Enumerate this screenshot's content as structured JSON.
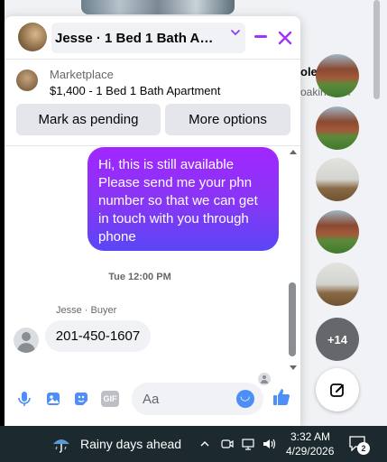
{
  "background": {
    "profile_text": "ole",
    "profile_sub": "oakin...om"
  },
  "chat": {
    "title": "Jesse · 1 Bed 1 Bath Apart...",
    "marketplace": {
      "label": "Marketplace",
      "listing": "$1,400 - 1 Bed 1 Bath Apartment"
    },
    "buttons": {
      "mark_pending": "Mark as pending",
      "more_options": "More options"
    },
    "messages": {
      "outgoing": "Hi, this is still available Please send me your phn number so that we can get in touch with you through phone",
      "timestamp": "Tue 12:00 PM",
      "sender": "Jesse · Buyer",
      "incoming": "201-450-1607"
    },
    "composer": {
      "placeholder": "Aa",
      "gif_label": "GIF"
    },
    "colors": {
      "accent": "#a033ff",
      "bubble_top": "#a126ff",
      "bubble_bottom": "#5a46f5",
      "icon": "#7e5bef",
      "like": "#4e8ef7"
    }
  },
  "side_bubbles": {
    "more_count": "+14"
  },
  "taskbar": {
    "weather": "Rainy days ahead",
    "time": "3:32 AM",
    "date": "4/29/2026",
    "notification_count": "2"
  }
}
